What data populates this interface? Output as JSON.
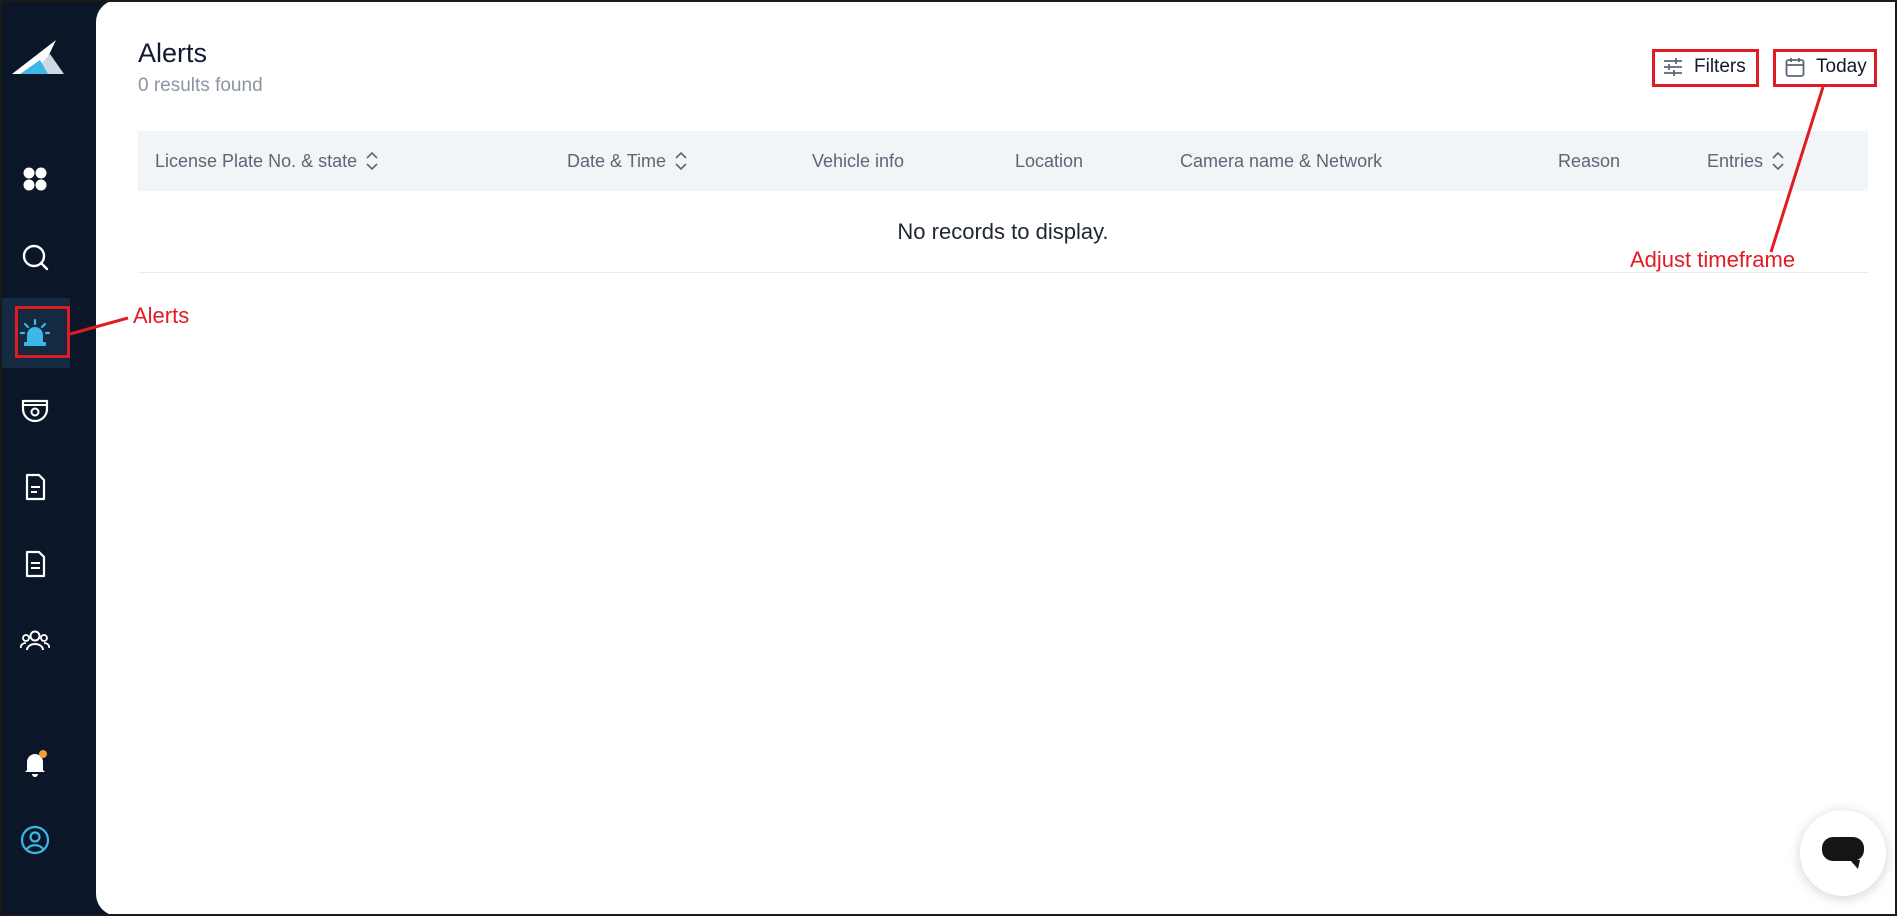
{
  "sidebar": {
    "items": [
      {
        "icon": "dashboard-icon"
      },
      {
        "icon": "search-icon"
      },
      {
        "icon": "alarm-siren-icon",
        "active": true
      },
      {
        "icon": "camera-icon"
      },
      {
        "icon": "document-icon"
      },
      {
        "icon": "report-icon"
      },
      {
        "icon": "users-icon"
      },
      {
        "icon": "bell-icon"
      },
      {
        "icon": "profile-icon"
      }
    ],
    "accent": "#3db6e8",
    "notification_dot": "#f0a030"
  },
  "header": {
    "title": "Alerts",
    "results": "0 results found",
    "filters_label": "Filters",
    "date_label": "Today"
  },
  "table": {
    "columns": [
      {
        "label": "License Plate No. & state",
        "sortable": true
      },
      {
        "label": "Date & Time",
        "sortable": true
      },
      {
        "label": "Vehicle info",
        "sortable": false
      },
      {
        "label": "Location",
        "sortable": false
      },
      {
        "label": "Camera name & Network",
        "sortable": false
      },
      {
        "label": "Reason",
        "sortable": false
      },
      {
        "label": "Entries",
        "sortable": true
      }
    ],
    "empty_message": "No records to display."
  },
  "annotations": {
    "alerts": "Alerts",
    "timeframe": "Adjust timeframe",
    "color": "#e01b24"
  }
}
